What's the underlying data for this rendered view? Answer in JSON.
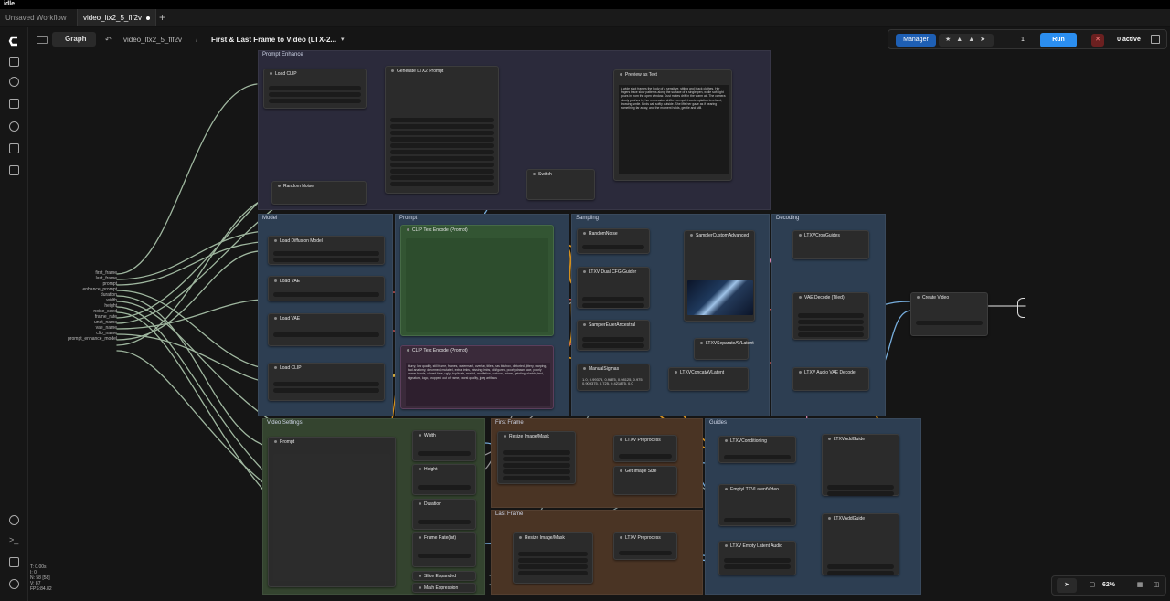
{
  "os": {
    "title": "idle"
  },
  "tabs": [
    {
      "label": "Unsaved Workflow"
    },
    {
      "label": "video_ltx2_5_flf2v"
    }
  ],
  "toolbar": {
    "graph_label": "Graph",
    "workflow_name": "video_ltx2_5_flf2v",
    "subgraph_name": "First & Last Frame to Video (LTX-2...",
    "manager_label": "Manager",
    "count": "1",
    "run_label": "Run",
    "active_label": "0 active"
  },
  "groups": {
    "prompt": "Prompt Enhance",
    "model": "Model",
    "prompt2": "Prompt",
    "sampling": "Sampling",
    "decoding": "Decoding",
    "settings": "Video Settings",
    "first": "First Frame",
    "last": "Last Frame",
    "guides": "Guides"
  },
  "nodes": {
    "load_clip": "Load CLIP",
    "gen_prompt": "Generate LTX2 Prompt",
    "preview_text": "Preview as Text",
    "ksel": "Switch",
    "random_noise": "Random Noise",
    "load_diffusion": "Load Diffusion Model",
    "load_vae": "Load VAE",
    "load_vae2": "Load VAE",
    "load_clip2": "Load CLIP",
    "clip_pos": "CLIP Text Encode (Prompt)",
    "clip_neg": "CLIP Text Encode (Prompt)",
    "random_noise2": "RandomNoise",
    "ltxv_cfg": "LTXV Dual CFG Guider",
    "sampler_select": "SamplerEulerAncestral",
    "manual_sigmas": "ManualSigmas",
    "sampler_custom": "SamplerCustomAdvanced",
    "separate_latent": "LTXVSeparateAVLatent",
    "concat_latent": "LTXVConcatAVLatent",
    "ltxv_cropguides": "LTXVCropGuides",
    "vae_decode": "VAE Decode (Tiled)",
    "audio_vae_decode": "LTXV Audio VAE Decode",
    "create_video": "Create Video",
    "prompt_node": "Prompt",
    "width": "Width",
    "height": "Height",
    "duration": "Duration",
    "framerate": "Frame Rate(int)",
    "slider_expanded": "Slide Expanded",
    "math_expression": "Math Expression",
    "resize_first": "Resize Image/Mask",
    "ltxv_pre1": "LTXV Preprocess",
    "get_image_size": "Get Image Size",
    "resize_last": "Resize Image/Mask",
    "ltxv_pre2": "LTXV Preprocess",
    "conditioning": "LTXVConditioning",
    "empty_latent": "EmptyLTXVLatentVideo",
    "empty_audio": "LTXV Empty Latent Audio",
    "add_guide1": "LTXVAddGuide",
    "add_guide2": "LTXVAddGuide"
  },
  "inputs": [
    "first_frame",
    "last_frame",
    "prompt",
    "enhance_prompt",
    "duration",
    "width",
    "height",
    "noise_seed",
    "frame_rate",
    "unet_name",
    "vae_name",
    "clip_name",
    "prompt_enhance_model"
  ],
  "prompt_text": "A wide shot frames the body of a sensitive, sitting and black clothes. Her fingers trace slow patterns along the surface of a single pen, while soft light pours in from the open window. Dust motes drift in the warm air. The camera slowly pushes in, her expression shifts from quiet contemplation to a faint, knowing smile. Birds call softly outside. She lifts her gaze as if hearing something far away, and the moment holds, gentle and still.",
  "neg_text": "blurry, low quality, still frame, frames, watermark, overlay, titles, has blurbox, distorted, jittery, warping, bad anatomy, deformed, mutated, extra limbs, missing limbs, disfigured, poorly drawn face, poorly drawn hands, cloned face, ugly, duplicate, morbid, mutilation, cartoon, anime, painting, sketch, text, signature, logo, cropped, out of frame, worst quality, jpeg artifacts",
  "sigmas": "1.0, 0.99375, 0.9875, 0.98125, 0.975, 0.909375, 0.725, 0.421875, 0.0",
  "stats": {
    "l1": "T: 0.00s",
    "l2": "I: 0",
    "l3": "N: 58 [58]",
    "l4": "V: 87",
    "l5": "FPS:84.82"
  },
  "zoom": "62%",
  "icons": [
    "comfy-logo",
    "layers-icon",
    "queue-icon",
    "nodes-icon",
    "models-icon",
    "templates-icon",
    "workflow-icon",
    "help-icon",
    "terminal-icon",
    "keyboard-icon",
    "settings-icon"
  ]
}
